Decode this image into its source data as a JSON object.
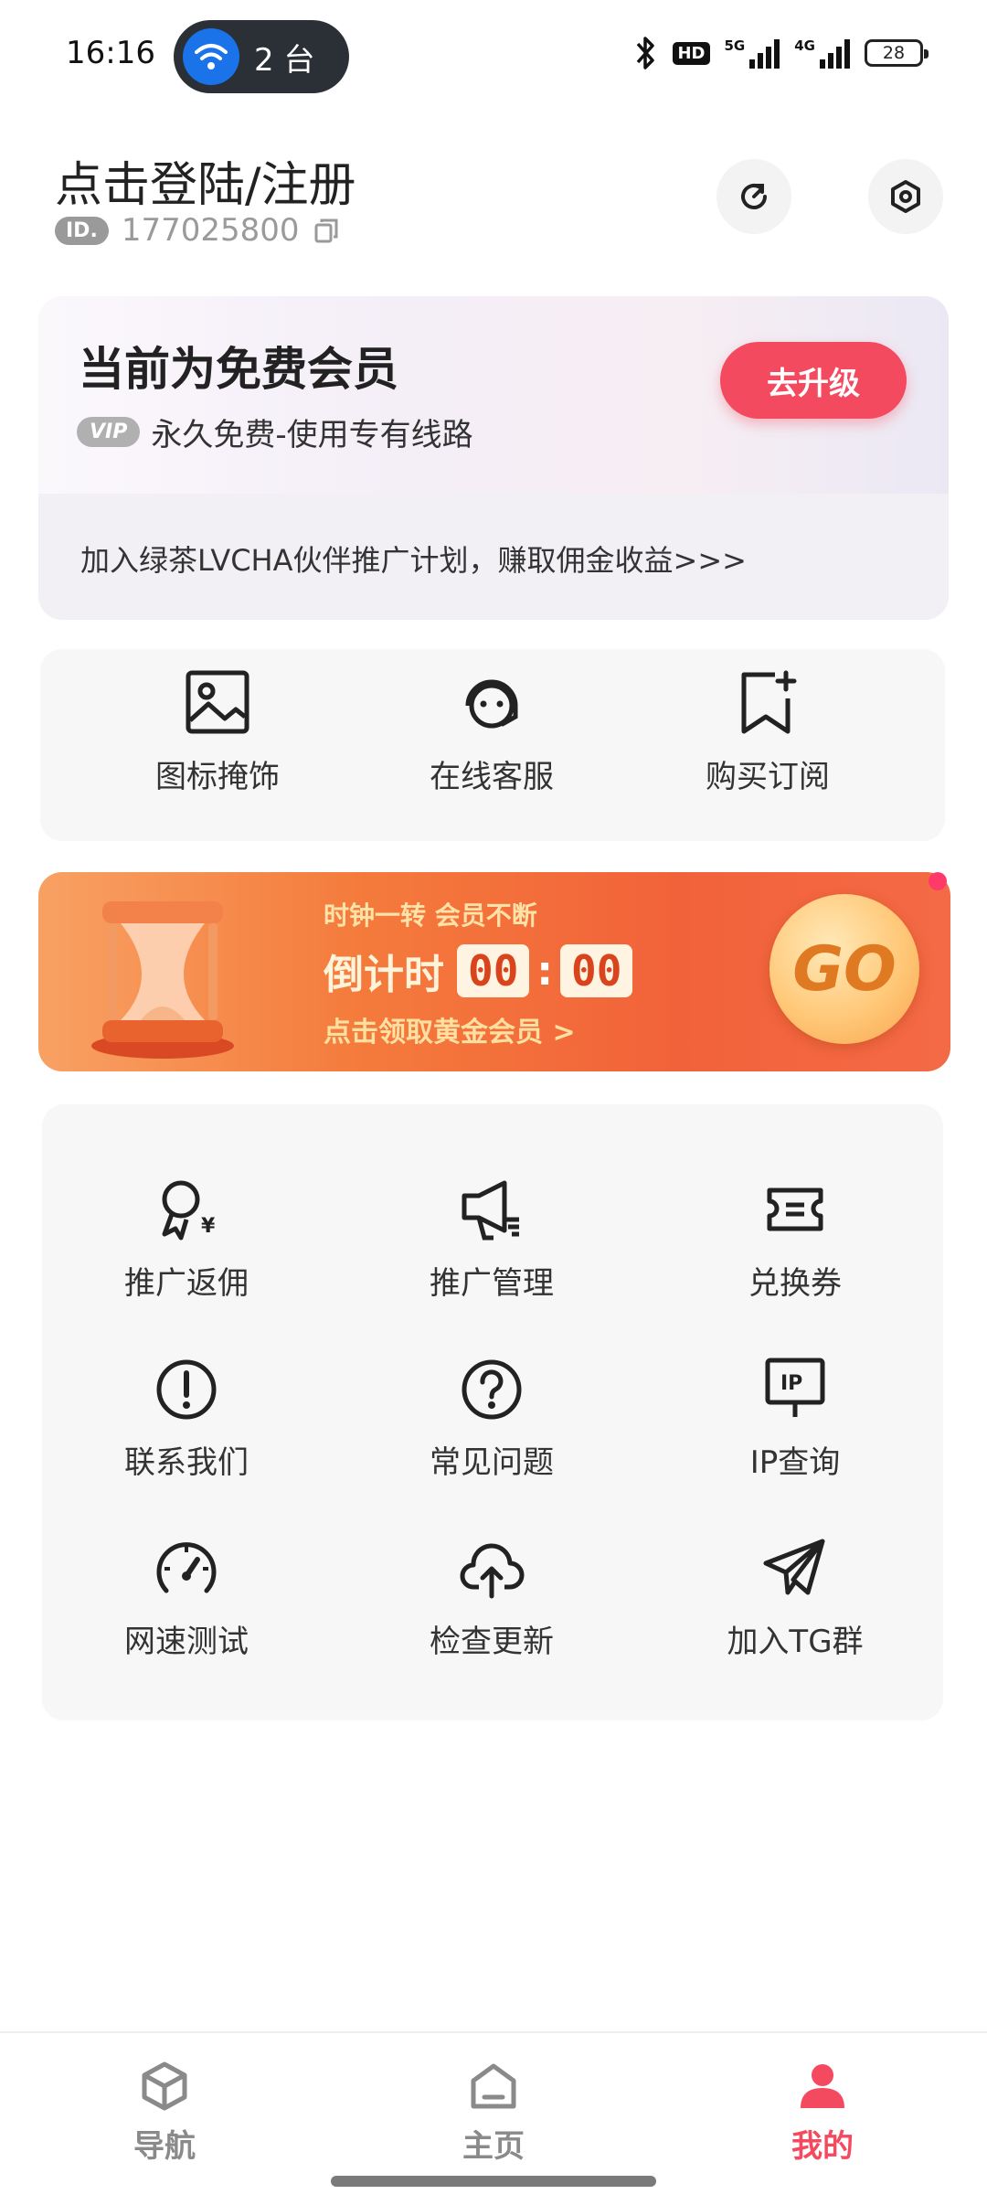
{
  "status_bar": {
    "time": "16:16",
    "hotspot_count": "2 台",
    "hd_label": "HD",
    "signal1_label": "5G",
    "signal2_label": "4G",
    "battery": "28"
  },
  "header": {
    "login_title": "点击登陆/注册",
    "id_badge": "ID.",
    "id_value": "177025800"
  },
  "vip_card": {
    "title": "当前为免费会员",
    "tag": "VIP",
    "subtitle": "永久免费-使用专有线路",
    "upgrade_label": "去升级",
    "partner_text": "加入绿茶LVCHA伙伴推广计划，赚取佣金收益>>>"
  },
  "quick_actions": [
    {
      "label": "图标掩饰",
      "icon": "image-icon"
    },
    {
      "label": "在线客服",
      "icon": "customer-service-icon"
    },
    {
      "label": "购买订阅",
      "icon": "bookmark-plus-icon"
    }
  ],
  "promo": {
    "line1": "时钟一转 会员不断",
    "countdown_label": "倒计时",
    "minutes": "00",
    "seconds": "00",
    "colon": ":",
    "line3": "点击领取黄金会员 >",
    "go_label": "GO",
    "accent": "#f47b3c"
  },
  "features": [
    {
      "label": "推广返佣",
      "icon": "rebate-icon"
    },
    {
      "label": "推广管理",
      "icon": "megaphone-icon"
    },
    {
      "label": "兑换券",
      "icon": "coupon-icon"
    },
    {
      "label": "联系我们",
      "icon": "alert-circle-icon"
    },
    {
      "label": "常见问题",
      "icon": "question-circle-icon"
    },
    {
      "label": "IP查询",
      "icon": "ip-icon"
    },
    {
      "label": "网速测试",
      "icon": "speedometer-icon"
    },
    {
      "label": "检查更新",
      "icon": "cloud-upload-icon"
    },
    {
      "label": "加入TG群",
      "icon": "telegram-icon"
    }
  ],
  "ip_icon_text": "IP",
  "bottom_nav": [
    {
      "label": "导航",
      "icon": "cube-icon",
      "active": false
    },
    {
      "label": "主页",
      "icon": "home-icon",
      "active": false
    },
    {
      "label": "我的",
      "icon": "user-icon",
      "active": true
    }
  ],
  "colors": {
    "brand_red": "#f34a5f",
    "nav_inactive": "#8a8a8a"
  }
}
